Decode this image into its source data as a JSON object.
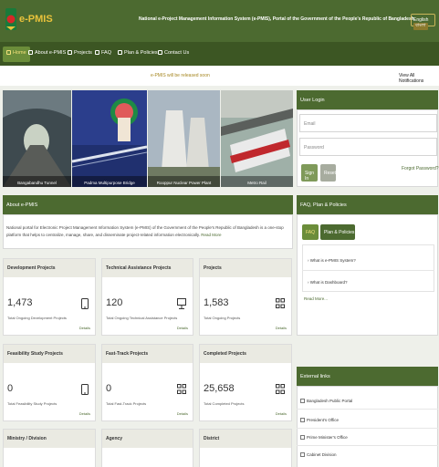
{
  "header": {
    "logo_text": "e-PMIS",
    "site_title": "National e-Project Management Information System (e-PMIS), Portal of the Government of the People's Republic of Bangladesh",
    "lang_en": "English",
    "lang_bn": "বাংলা"
  },
  "nav": {
    "home": "Home",
    "about": "About e-PMIS",
    "projects": "Projects",
    "faq": "FAQ",
    "plan": "Plan & Policies",
    "contact": "Contact Us"
  },
  "notice": {
    "marquee": "e-PMIS will be released soon",
    "view_all": "View All Notifications"
  },
  "gallery": {
    "captions": [
      "Bangabandhu Tunnel",
      "Padma Multipurpose Bridge",
      "Rooppur Nuclear Power Plant",
      "Metro Rail"
    ]
  },
  "login": {
    "title": "User Login",
    "email_placeholder": "Email",
    "password_placeholder": "Password",
    "sign_in": "Sign In",
    "reset": "Reset",
    "forgot": "Forgot Password?"
  },
  "about": {
    "title": "About e-PMIS",
    "text": "National portal for Electronic Project Management Information System (e-PMIS) of the Government of the People's Republic of Bangladesh is a one-stop platform that helps to centralize, manage, share, and disseminate project-related information electronically.",
    "read_more": "Read More"
  },
  "cards": [
    {
      "title": "Development Projects",
      "value": "1,473",
      "sub": "Total Ongoing Development Projects",
      "icon": "mobile-icon",
      "detail": "Details"
    },
    {
      "title": "Technical Assistance Projects",
      "value": "120",
      "sub": "Total Ongoing Technical Assistance Projects",
      "icon": "monitor-icon",
      "detail": "Details"
    },
    {
      "title": "Projects",
      "value": "1,583",
      "sub": "Total Ongoing Projects",
      "icon": "grid-icon",
      "detail": "Details"
    },
    {
      "title": "Feasibility Study Projects",
      "value": "0",
      "sub": "Total Feasibility Study Projects",
      "icon": "mobile-icon",
      "detail": "Details"
    },
    {
      "title": "Fast-Track Projects",
      "value": "0",
      "sub": "Total Fast-Track Projects",
      "icon": "grid-icon",
      "detail": "Details"
    },
    {
      "title": "Completed Projects",
      "value": "25,658",
      "sub": "Total Completed Projects",
      "icon": "grid-icon",
      "detail": "Details"
    },
    {
      "title": "Ministry / Division",
      "value": "",
      "sub": "",
      "icon": "",
      "detail": ""
    },
    {
      "title": "Agency",
      "value": "",
      "sub": "",
      "icon": "",
      "detail": ""
    },
    {
      "title": "District",
      "value": "",
      "sub": "",
      "icon": "",
      "detail": ""
    }
  ],
  "faq": {
    "title": "FAQ, Plan & Policies",
    "tab_faq": "FAQ",
    "tab_plan": "Plan & Policies",
    "items": [
      "What is e-PMIS System?",
      "What is Dashboard?"
    ],
    "read_more": "Read More..."
  },
  "links": {
    "title": "External links",
    "items": [
      "Bangladesh Public Portal",
      "President's Office",
      "Prime Minister's Office",
      "Cabinet Division"
    ]
  },
  "colors": {
    "header_green": "#4c6a30",
    "nav_green": "#3c5623",
    "gold": "#e9c23b"
  }
}
